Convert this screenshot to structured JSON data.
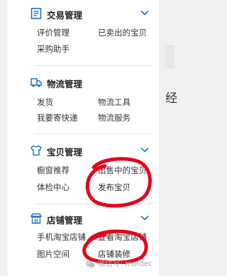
{
  "sidebar": {
    "sections": [
      {
        "title": "交易管理",
        "icon": "trade-document-icon",
        "items": [
          "评价管理",
          "已卖出的宝贝",
          "采购助手"
        ]
      },
      {
        "title": "物流管理",
        "icon": "truck-icon",
        "items": [
          "发货",
          "物流工具",
          "我要寄快递",
          "物流服务"
        ]
      },
      {
        "title": "宝贝管理",
        "icon": "shirt-icon",
        "items": [
          "橱窗推荐",
          "出售中的宝贝",
          "体检中心",
          "发布宝贝"
        ]
      },
      {
        "title": "店铺管理",
        "icon": "storefront-icon",
        "items": [
          "手机淘宝店铺",
          "查看淘宝店铺",
          "图片空间",
          "店铺装修"
        ]
      }
    ]
  },
  "right_panel": {
    "glyph": "经"
  },
  "watermark": {
    "text": "微信号: moldec"
  },
  "colors": {
    "accent": "#1a73c8",
    "annotation": "#e8001c"
  }
}
